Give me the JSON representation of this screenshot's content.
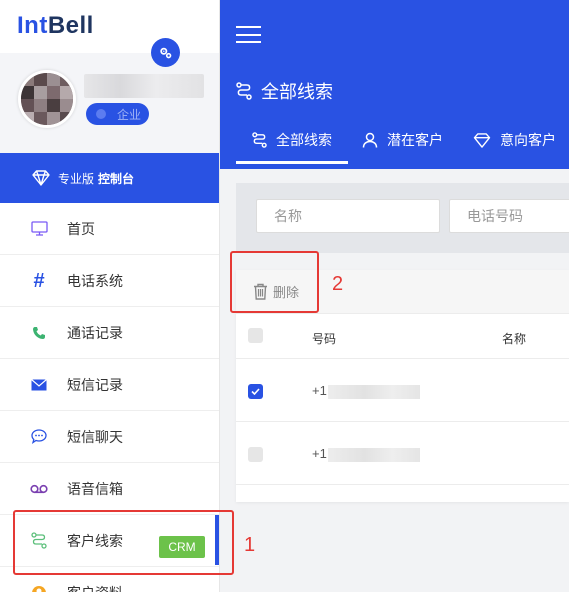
{
  "brand": {
    "part1": "Int",
    "part2": "Bell"
  },
  "profile": {
    "badge": "企业"
  },
  "pro_bar": {
    "label": "专业版",
    "bold": "控制台"
  },
  "nav": [
    {
      "label": "首页",
      "icon": "monitor-icon",
      "color": "#7a5af5"
    },
    {
      "label": "电话系统",
      "icon": "hash-icon",
      "color": "#2952e3"
    },
    {
      "label": "通话记录",
      "icon": "phone-icon",
      "color": "#3cb371"
    },
    {
      "label": "短信记录",
      "icon": "envelope-icon",
      "color": "#2952e3"
    },
    {
      "label": "短信聊天",
      "icon": "chat-bubble-icon",
      "color": "#2952e3"
    },
    {
      "label": "语音信箱",
      "icon": "voicemail-icon",
      "color": "#7a3fb0"
    },
    {
      "label": "客户线索",
      "icon": "route-icon",
      "color": "#5bbf7a",
      "badge": "CRM"
    },
    {
      "label": "客户资料",
      "icon": "person-icon",
      "color": "#f5a623"
    }
  ],
  "header": {
    "title": "全部线索",
    "tabs": [
      {
        "label": "全部线索",
        "icon": "route-icon"
      },
      {
        "label": "潜在客户",
        "icon": "person-icon"
      },
      {
        "label": "意向客户",
        "icon": "diamond-icon"
      }
    ]
  },
  "filters": {
    "name_placeholder": "名称",
    "phone_placeholder": "电话号码"
  },
  "toolbar": {
    "delete_label": "删除"
  },
  "table": {
    "columns": [
      "号码",
      "名称"
    ],
    "rows": [
      {
        "number_prefix": "+1",
        "checked": true
      },
      {
        "number_prefix": "+1",
        "checked": false
      }
    ]
  },
  "annotations": {
    "one": "1",
    "two": "2"
  },
  "colors": {
    "accent": "#2952e3",
    "crm_badge": "#6cc24a",
    "annotation": "#e53935"
  }
}
